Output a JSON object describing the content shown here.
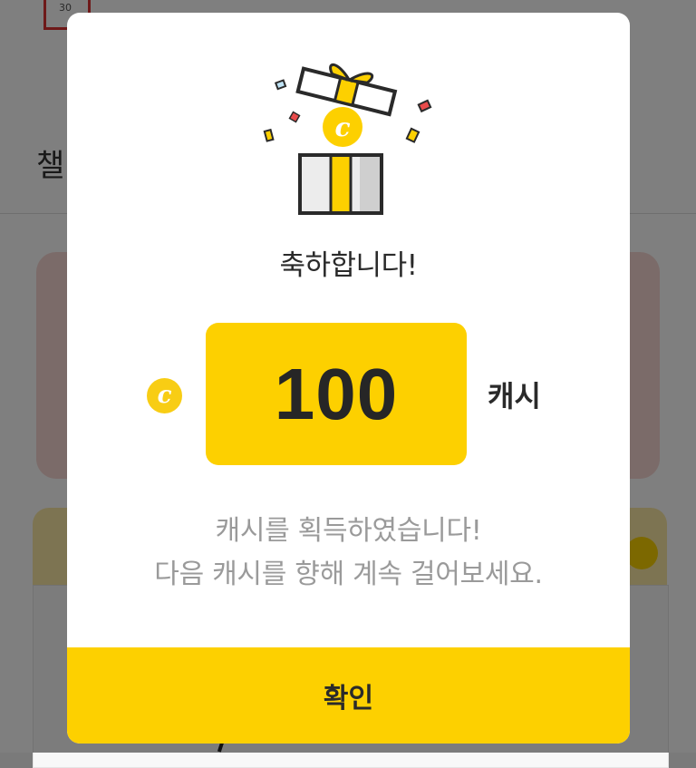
{
  "background": {
    "calendar_day": "30",
    "tab_text": "챌"
  },
  "modal": {
    "illustration": "gift-box-with-coin-icon",
    "coin_symbol": "c",
    "title": "축하합니다!",
    "amount": "100",
    "unit": "캐시",
    "message_line1": "캐시를 획득하였습니다!",
    "message_line2": "다음 캐시를 향해 계속 걸어보세요.",
    "confirm_label": "확인"
  },
  "colors": {
    "accent_yellow": "#fdd000",
    "coin_yellow": "#f8cd14",
    "text_dark": "#2a2a2a",
    "text_muted": "#9a9a9a"
  }
}
